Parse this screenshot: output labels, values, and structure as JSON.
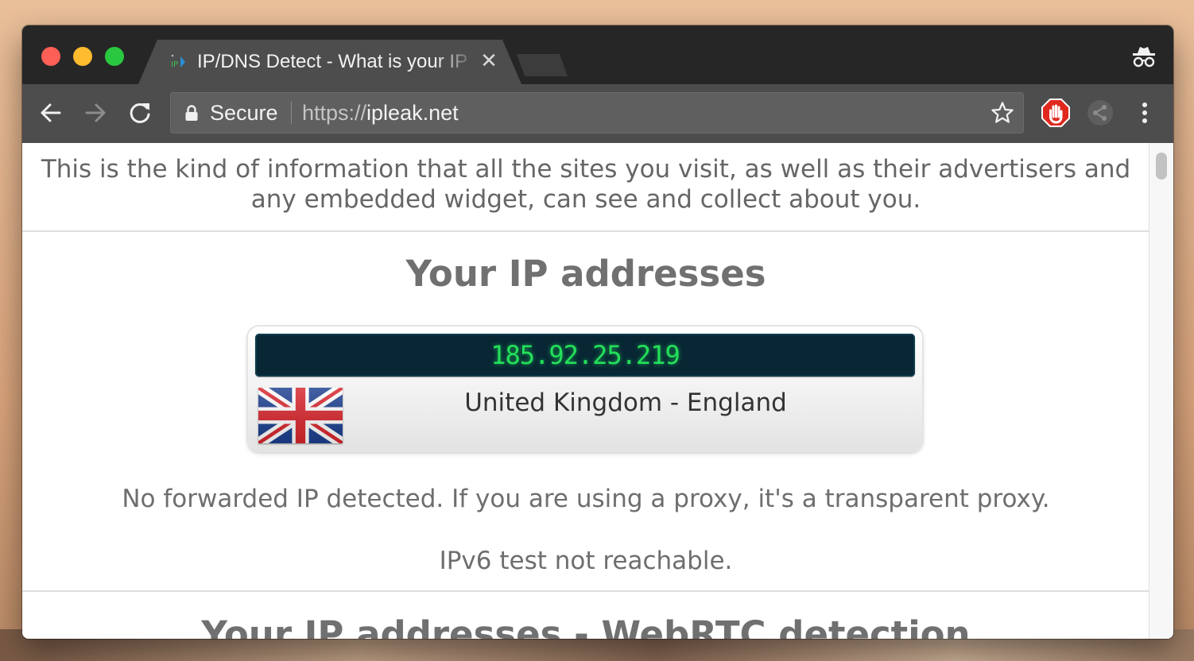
{
  "browser": {
    "tab": {
      "title": "IP/DNS Detect - What is your IP",
      "close_glyph": "✕"
    },
    "omnibox": {
      "security_label": "Secure",
      "url_scheme": "https://",
      "url_host": "ipleak.net"
    },
    "icons": {
      "back": "back-arrow-icon",
      "forward": "forward-arrow-icon",
      "reload": "reload-icon",
      "lock": "lock-icon",
      "bookmark": "star-icon",
      "extension_block": "hand-stop-icon",
      "extension_share": "share-icon",
      "menu": "vertical-dots-icon",
      "incognito": "incognito-icon"
    },
    "colors": {
      "titlebar": "#262626",
      "toolbar": "#4d4d4d",
      "omnibox": "#5f5f5f"
    }
  },
  "page": {
    "intro": "This is the kind of information that all the sites you visit, as well as their advertisers and any embedded widget, can see and collect about you.",
    "ip_section": {
      "title": "Your IP addresses",
      "ip": "185.92.25.219",
      "location": "United Kingdom - England",
      "flag": "uk-flag-icon",
      "forwarded_note": "No forwarded IP detected. If you are using a proxy, it's a transparent proxy.",
      "ipv6_note": "IPv6 test not reachable."
    },
    "webrtc_section": {
      "title": "Your IP addresses - WebRTC detection"
    },
    "colors": {
      "ip_display_bg": "#082634",
      "ip_text": "#23e05a",
      "heading_text": "#707070"
    }
  }
}
